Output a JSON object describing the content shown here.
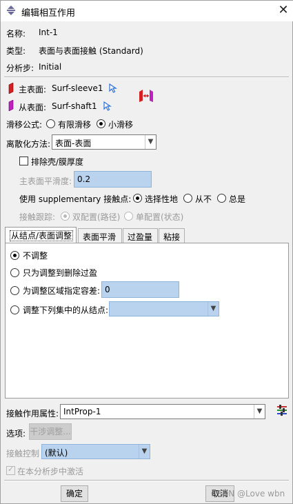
{
  "window": {
    "title": "编辑相互作用",
    "close": "✕"
  },
  "header": {
    "name_label": "名称:",
    "name_value": "Int-1",
    "type_label": "类型:",
    "type_value": "表面与表面接触 (Standard)",
    "step_label": "分析步:",
    "step_value": "Initial"
  },
  "surfaces": {
    "master_label": "主表面:",
    "master_value": "Surf-sleeve1",
    "slave_label": "从表面:",
    "slave_value": "Surf-shaft1"
  },
  "sliding": {
    "label": "滑移公式:",
    "opt1": "有限滑移",
    "opt2": "小滑移"
  },
  "discretization": {
    "label": "离散化方法:",
    "value": "表面-表面"
  },
  "shell": {
    "label": "排除壳/膜厚度"
  },
  "smoothing": {
    "label": "主表面平滑度:",
    "value": "0.2"
  },
  "supplementary": {
    "label": "使用 supplementary 接触点:",
    "opt1": "选择性地",
    "opt2": "从不",
    "opt3": "总是"
  },
  "tracking": {
    "label": "接触跟踪:",
    "opt1": "双配置(路径)",
    "opt2": "单配置(状态)"
  },
  "tabs": [
    "从结点/表面调整",
    "表面平滑",
    "过盈量",
    "粘接"
  ],
  "adjust": {
    "opt1": "不调整",
    "opt2": "只为调整到删除过盈",
    "opt3": "为调整区域指定容差:",
    "opt3_value": "0",
    "opt4": "调整下列集中的从结点:"
  },
  "property": {
    "label": "接触作用属性:",
    "value": "IntProp-1"
  },
  "options": {
    "label": "选项:",
    "button": "干涉调整..."
  },
  "control": {
    "label": "接触控制",
    "value": "(默认)"
  },
  "activate": {
    "label": "在本分析步中激活"
  },
  "footer": {
    "ok": "确定",
    "cancel": "取消",
    "watermark": "CSDN @Love wbn"
  },
  "colors": {
    "input_blue": "#b9d3ee",
    "master_red": "#d42020",
    "slave_magenta": "#c020c0",
    "cursor_blue": "#2a6fd6"
  }
}
